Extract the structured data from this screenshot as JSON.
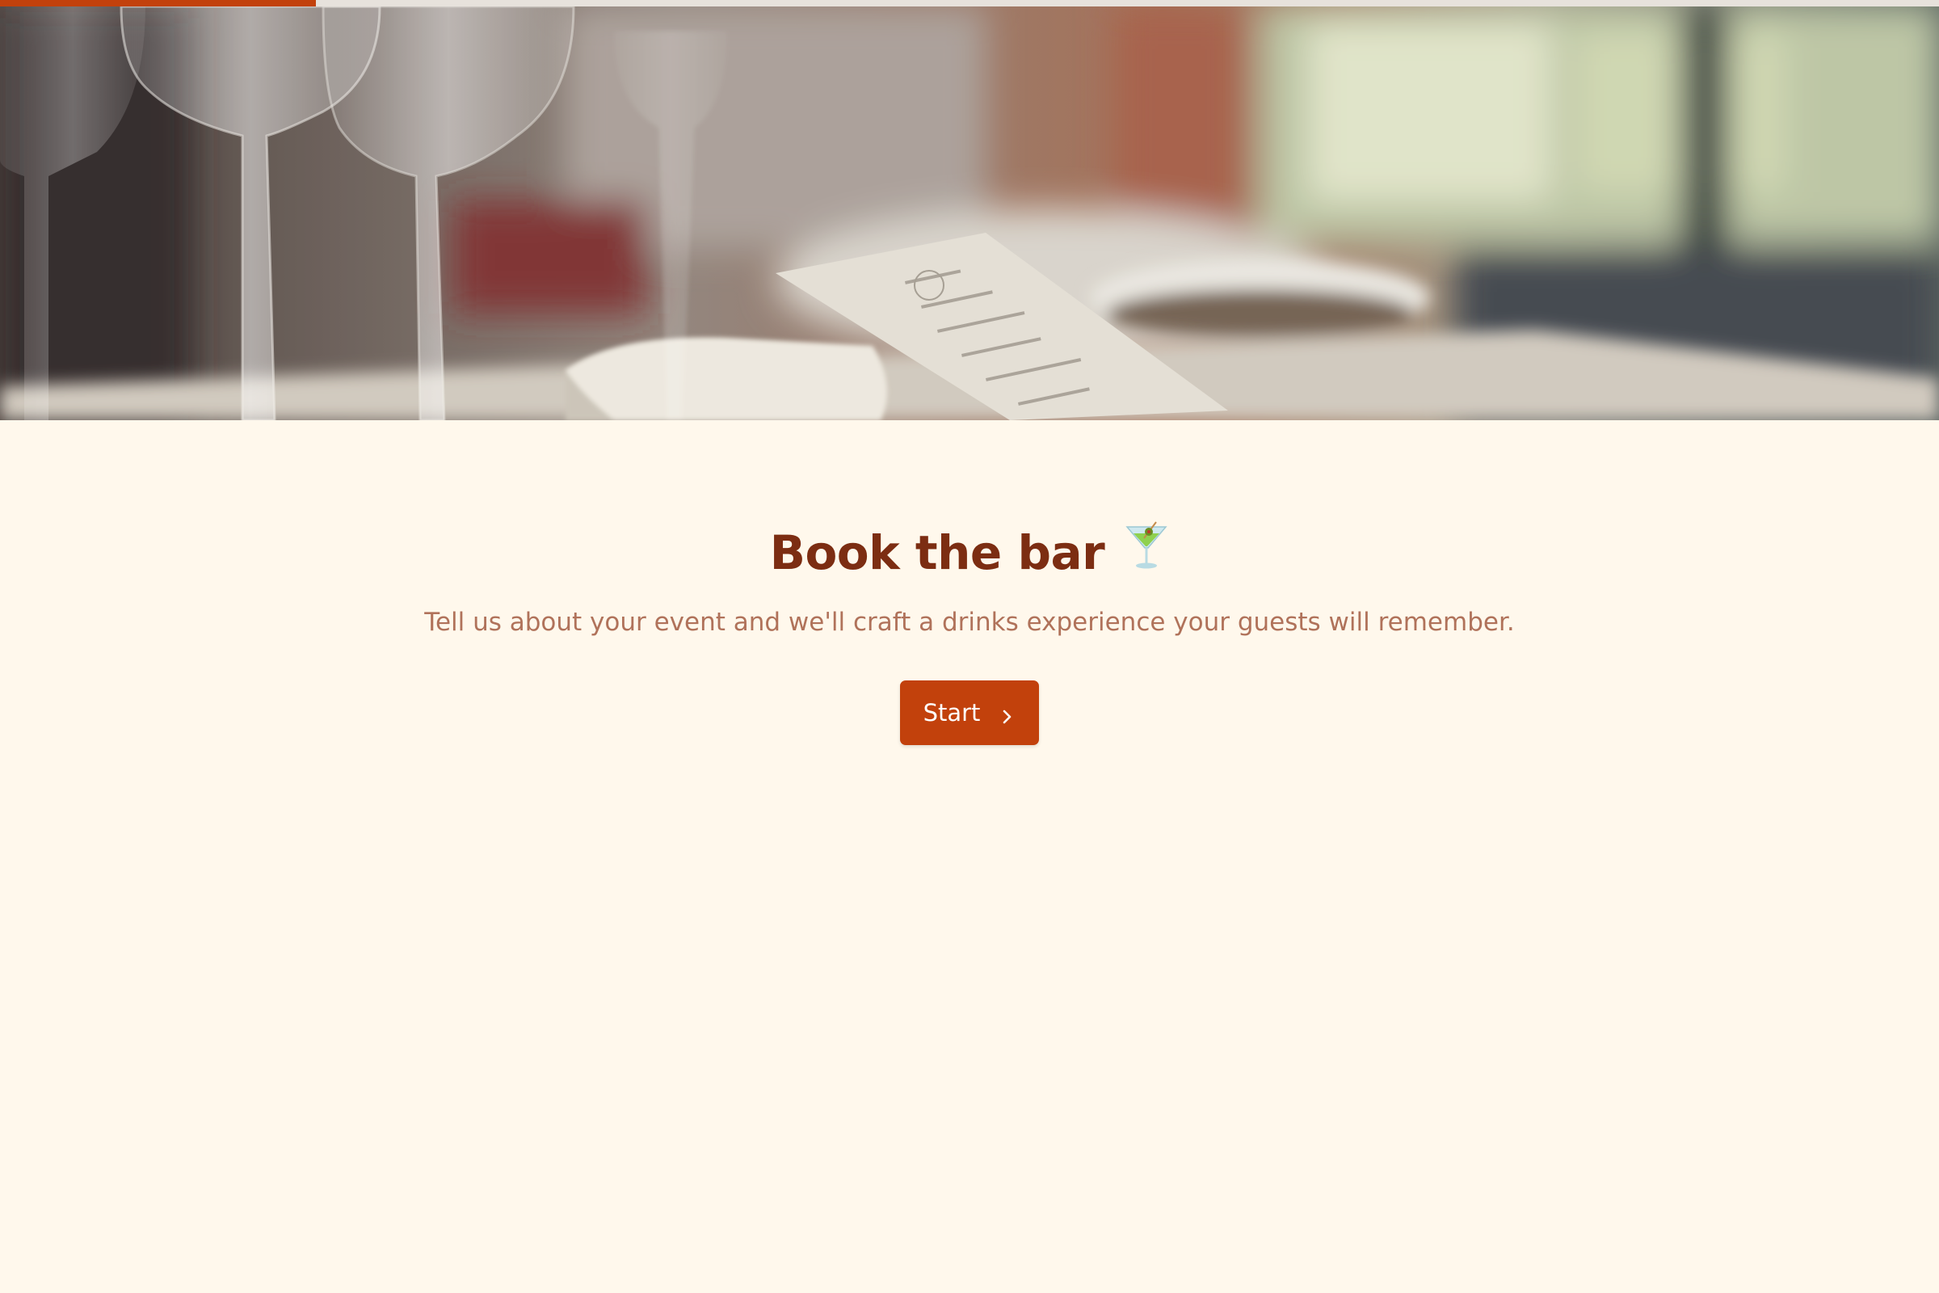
{
  "progress": {
    "fraction": 0.163,
    "color": "#c2410c"
  },
  "hero": {
    "description_icon": "restaurant-table-photo"
  },
  "page": {
    "title": "Book the bar",
    "title_emoji": "🍸",
    "subtitle": "Tell us about your event and we'll craft a drinks experience your guests will remember.",
    "start_label": "Start",
    "start_icon": "chevron-right-icon"
  },
  "colors": {
    "background": "#fff8ec",
    "title": "#7c2d12",
    "subtitle": "#b0725a",
    "accent": "#c2410c"
  }
}
